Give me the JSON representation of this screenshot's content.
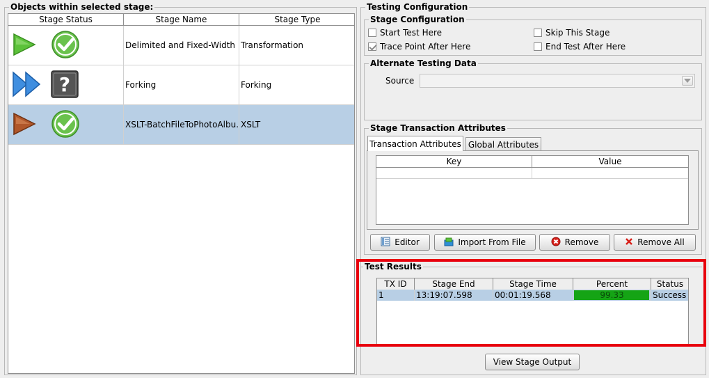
{
  "left_panel": {
    "title": "Objects within selected stage:",
    "columns": [
      "Stage Status",
      "Stage Name",
      "Stage Type"
    ],
    "rows": [
      {
        "name": "Delimited and Fixed-Width F...",
        "type": "Transformation",
        "run_icon": "play-green-icon",
        "status_icon": "check-circle-icon"
      },
      {
        "name": "Forking",
        "type": "Forking",
        "run_icon": "fast-forward-blue-icon",
        "status_icon": "question-square-icon"
      },
      {
        "name": "XSLT-BatchFileToPhotoAlbu...",
        "type": "XSLT",
        "run_icon": "play-brown-icon",
        "status_icon": "check-circle-icon"
      }
    ]
  },
  "testing": {
    "title": "Testing Configuration",
    "stage_config": {
      "title": "Stage Configuration",
      "start_test": "Start Test Here",
      "skip_stage": "Skip This Stage",
      "trace_point": "Trace Point After Here",
      "end_test": "End Test After Here"
    },
    "alt_data": {
      "title": "Alternate Testing Data",
      "source_label": "Source",
      "source_value": ""
    },
    "attributes": {
      "title": "Stage Transaction Attributes",
      "tabs": [
        "Transaction Attributes",
        "Global Attributes"
      ],
      "columns": [
        "Key",
        "Value"
      ],
      "buttons": {
        "editor": "Editor",
        "import": "Import From File",
        "remove": "Remove",
        "remove_all": "Remove All"
      }
    },
    "results": {
      "title": "Test Results",
      "columns": [
        "TX ID",
        "Stage End",
        "Stage Time",
        "Percent",
        "Status"
      ],
      "rows": [
        {
          "tx_id": "1",
          "stage_end": "13:19:07.598",
          "stage_time": "00:01:19.568",
          "percent": "99.33",
          "status": "Success"
        }
      ]
    },
    "view_output": "View Stage Output"
  },
  "colors": {
    "highlight_border": "#e8000d",
    "selected_row": "#b8cfe5",
    "progress_green": "#15a415"
  }
}
